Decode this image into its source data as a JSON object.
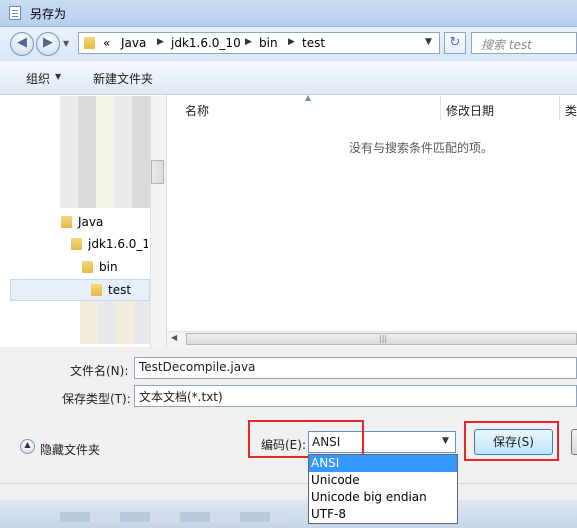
{
  "window": {
    "title": "另存为"
  },
  "address": {
    "prefix": "«",
    "crumbs": [
      "Java",
      "jdk1.6.0_10",
      "bin",
      "test"
    ],
    "search_placeholder": "搜索 test"
  },
  "toolbar": {
    "organize_label": "组织",
    "new_folder_label": "新建文件夹"
  },
  "tree": {
    "items": [
      "Java",
      "jdk1.6.0_10",
      "bin",
      "test"
    ]
  },
  "list": {
    "columns": [
      "名称",
      "修改日期",
      "类"
    ],
    "empty_message": "没有与搜索条件匹配的项。"
  },
  "form": {
    "filename_label": "文件名(N):",
    "filename_value": "TestDecompile.java",
    "type_label": "保存类型(T):",
    "type_value": "文本文档(*.txt)",
    "hide_folders_label": "隐藏文件夹",
    "encoding_label": "编码(E):",
    "encoding_value": "ANSI",
    "save_label": "保存(S)"
  },
  "encoding_options": [
    "ANSI",
    "Unicode",
    "Unicode big endian",
    "UTF-8"
  ],
  "colors": {
    "highlight": "#3399ff",
    "annotation_red": "#e8262a"
  }
}
